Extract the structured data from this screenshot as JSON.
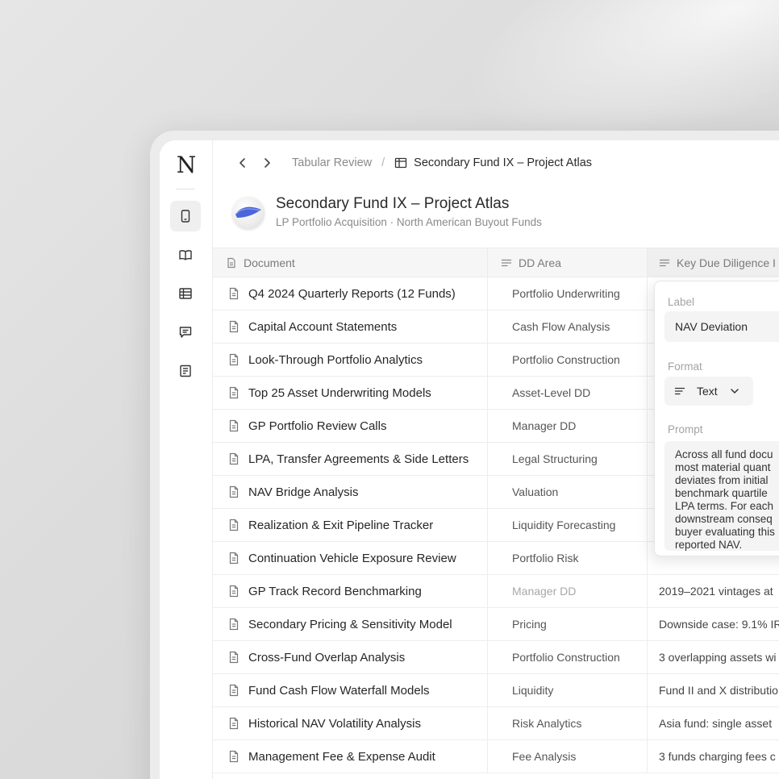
{
  "brand": {
    "logo_letter": "N"
  },
  "rail": {
    "items": [
      {
        "name": "document-icon",
        "active": true
      },
      {
        "name": "book-icon",
        "active": false
      },
      {
        "name": "table-icon",
        "active": false
      },
      {
        "name": "chat-icon",
        "active": false
      },
      {
        "name": "notes-icon",
        "active": false
      }
    ]
  },
  "breadcrumb": {
    "parent": "Tabular Review",
    "separator": "/",
    "current": "Secondary Fund IX – Project Atlas"
  },
  "project": {
    "title": "Secondary Fund IX – Project Atlas",
    "subtitle": "LP Portfolio Acquisition · North American Buyout Funds"
  },
  "table": {
    "columns": [
      "Document",
      "DD Area",
      "Key Due Diligence I"
    ],
    "rows": [
      {
        "document": "Q4 2024 Quarterly Reports (12 Funds)",
        "dd_area": "Portfolio Underwriting",
        "finding": ""
      },
      {
        "document": "Capital Account Statements",
        "dd_area": "Cash Flow Analysis",
        "finding": ""
      },
      {
        "document": "Look-Through Portfolio Analytics",
        "dd_area": "Portfolio Construction",
        "finding": ""
      },
      {
        "document": "Top 25 Asset Underwriting Models",
        "dd_area": "Asset-Level DD",
        "finding": ""
      },
      {
        "document": "GP Portfolio Review Calls",
        "dd_area": "Manager DD",
        "finding": ""
      },
      {
        "document": "LPA, Transfer Agreements & Side Letters",
        "dd_area": "Legal Structuring",
        "finding": ""
      },
      {
        "document": "NAV Bridge Analysis",
        "dd_area": "Valuation",
        "finding": ""
      },
      {
        "document": "Realization & Exit Pipeline Tracker",
        "dd_area": "Liquidity Forecasting",
        "finding": ""
      },
      {
        "document": "Continuation Vehicle Exposure Review",
        "dd_area": "Portfolio Risk",
        "finding": ""
      },
      {
        "document": "GP Track Record Benchmarking",
        "dd_area": "Manager DD",
        "finding": "2019–2021 vintages at",
        "muted": true
      },
      {
        "document": "Secondary Pricing & Sensitivity Model",
        "dd_area": "Pricing",
        "finding": "Downside case: 9.1% IR"
      },
      {
        "document": "Cross-Fund Overlap Analysis",
        "dd_area": "Portfolio Construction",
        "finding": "3 overlapping assets wi"
      },
      {
        "document": "Fund Cash Flow Waterfall Models",
        "dd_area": "Liquidity",
        "finding": "Fund II and X distributio"
      },
      {
        "document": "Historical NAV Volatility Analysis",
        "dd_area": "Risk Analytics",
        "finding": "Asia fund: single asset"
      },
      {
        "document": "Management Fee & Expense Audit",
        "dd_area": "Fee Analysis",
        "finding": "3 funds charging fees c"
      }
    ]
  },
  "column_popover": {
    "label_heading": "Label",
    "label_value": "NAV Deviation",
    "format_heading": "Format",
    "format_value": "Text",
    "prompt_heading": "Prompt",
    "prompt_lines": [
      "Across all fund docu",
      "most material quant",
      "deviates from initial",
      "benchmark quartile",
      "LPA terms. For each",
      "downstream conseq",
      "buyer evaluating this",
      "reported NAV."
    ]
  }
}
